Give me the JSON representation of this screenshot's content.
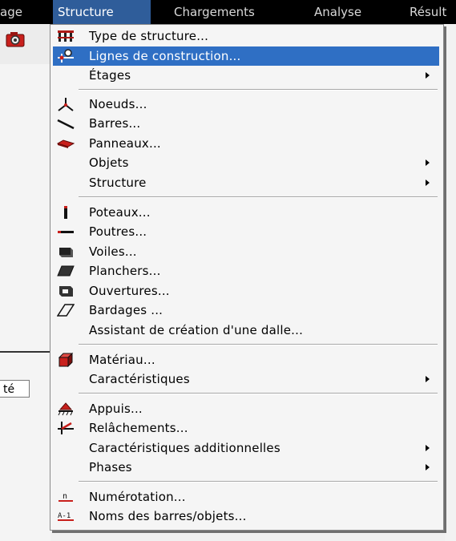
{
  "menubar": {
    "items": [
      {
        "label": "age"
      },
      {
        "label": "Structure"
      },
      {
        "label": "Chargements"
      },
      {
        "label": "Analyse"
      },
      {
        "label": "Résult"
      }
    ]
  },
  "background": {
    "tab_label": "té"
  },
  "menu": {
    "items": [
      {
        "label": "Type de structure...",
        "icon": "structure-type-icon"
      },
      {
        "label": "Lignes de construction...",
        "icon": "construction-lines-icon"
      },
      {
        "label": "Étages",
        "submenu": true
      },
      {
        "label": "Noeuds...",
        "icon": "node-icon"
      },
      {
        "label": "Barres...",
        "icon": "bar-icon"
      },
      {
        "label": "Panneaux...",
        "icon": "panel-icon"
      },
      {
        "label": "Objets",
        "submenu": true
      },
      {
        "label": "Structure",
        "submenu": true
      },
      {
        "label": "Poteaux...",
        "icon": "column-icon"
      },
      {
        "label": "Poutres...",
        "icon": "beam-icon"
      },
      {
        "label": "Voiles...",
        "icon": "wall-icon"
      },
      {
        "label": "Planchers...",
        "icon": "slab-icon"
      },
      {
        "label": "Ouvertures...",
        "icon": "opening-icon"
      },
      {
        "label": "Bardages ...",
        "icon": "cladding-icon"
      },
      {
        "label": "Assistant de création d'une dalle..."
      },
      {
        "label": "Matériau...",
        "icon": "material-icon"
      },
      {
        "label": "Caractéristiques",
        "submenu": true
      },
      {
        "label": "Appuis...",
        "icon": "support-icon"
      },
      {
        "label": "Relâchements...",
        "icon": "release-icon"
      },
      {
        "label": "Caractéristiques additionnelles",
        "submenu": true
      },
      {
        "label": "Phases",
        "submenu": true
      },
      {
        "label": "Numérotation...",
        "icon": "numbering-icon"
      },
      {
        "label": "Noms des barres/objets...",
        "icon": "bar-names-icon"
      }
    ]
  },
  "colors": {
    "highlight": "#2f6fc4",
    "menubar_bg": "#000000",
    "red_icon": "#c8201c"
  }
}
